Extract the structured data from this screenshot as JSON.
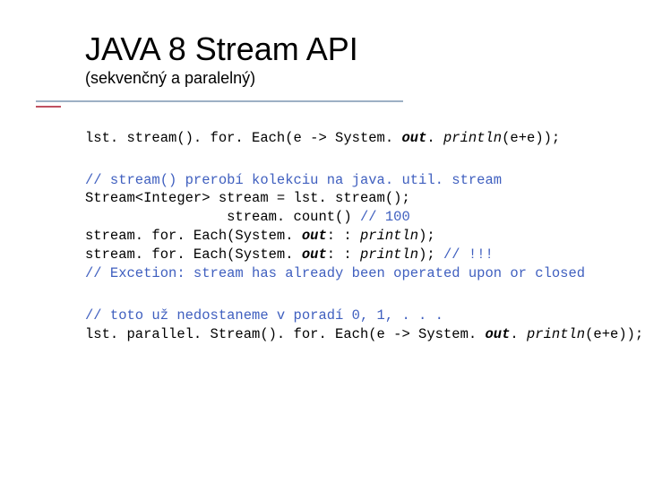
{
  "title": "JAVA 8 Stream API",
  "subtitle": "(sekvenčný a paralelný)",
  "code1": {
    "a": "lst. stream(). for. Each(e -> System. ",
    "b": "out",
    "c": ". ",
    "d": "println",
    "e": "(e+e));"
  },
  "code2": {
    "cm1": "// stream() prerobí kolekciu na java. util. stream",
    "l2": "Stream<Integer> stream = lst. stream();",
    "l3a": "                 stream. count() ",
    "l3b": "// 100",
    "l4a": "stream. for. Each(System. ",
    "l4b": "out",
    "l4c": ": : ",
    "l4d": "println",
    "l4e": ");",
    "l5a": "stream. for. Each(System. ",
    "l5b": "out",
    "l5c": ": : ",
    "l5d": "println",
    "l5e": "); ",
    "l5f": "// !!!",
    "cm2": "// Excetion: stream has already been operated upon or closed"
  },
  "code3": {
    "cm1": "// toto už nedostaneme v poradí 0, 1, . . .",
    "l2a": "lst. parallel. Stream(). for. Each(e -> System. ",
    "l2b": "out",
    "l2c": ". ",
    "l2d": "println",
    "l2e": "(e+e));"
  }
}
